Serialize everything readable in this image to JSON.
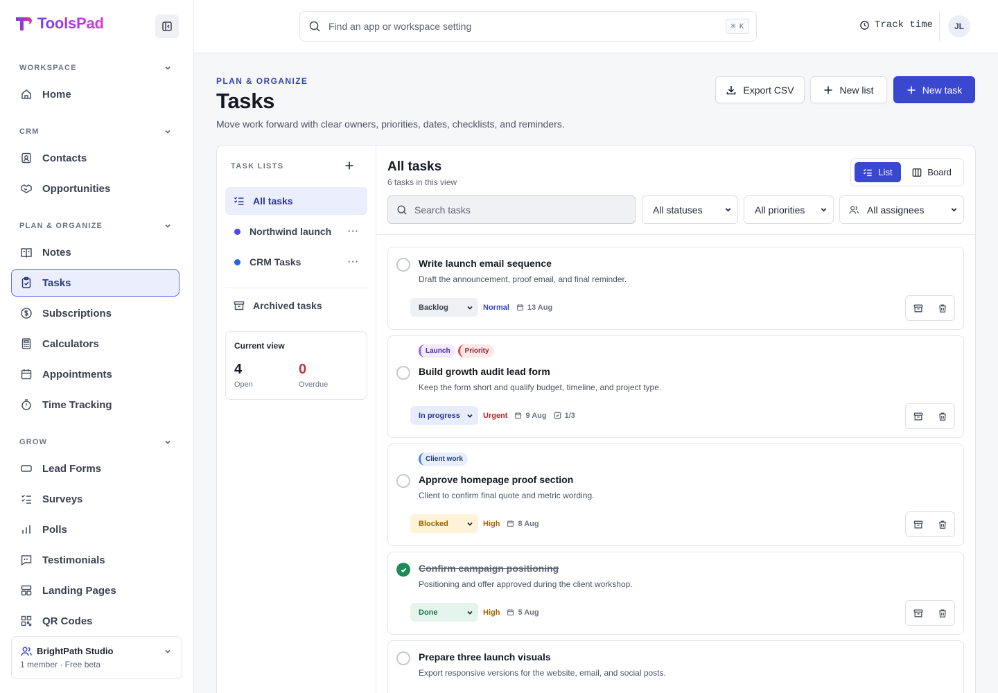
{
  "brand": {
    "name": "ToolsPad"
  },
  "topbar": {
    "search_placeholder": "Find an app or workspace setting",
    "shortcut": "⌘ K",
    "track_time": "Track time",
    "avatar_initials": "JL"
  },
  "sidebar": {
    "sections": {
      "workspace": "WORKSPACE",
      "crm": "CRM",
      "plan": "PLAN & ORGANIZE",
      "grow": "GROW"
    },
    "items": {
      "home": "Home",
      "contacts": "Contacts",
      "opportunities": "Opportunities",
      "notes": "Notes",
      "tasks": "Tasks",
      "subscriptions": "Subscriptions",
      "calculators": "Calculators",
      "appointments": "Appointments",
      "time_tracking": "Time Tracking",
      "lead_forms": "Lead Forms",
      "surveys": "Surveys",
      "polls": "Polls",
      "testimonials": "Testimonials",
      "landing_pages": "Landing Pages",
      "qr_codes": "QR Codes"
    },
    "workspace_card": {
      "name": "BrightPath Studio",
      "sub": "1 member · Free beta"
    }
  },
  "page": {
    "eyebrow": "PLAN & ORGANIZE",
    "title": "Tasks",
    "subtitle": "Move work forward with clear owners, priorities, dates, checklists, and reminders.",
    "buttons": {
      "export": "Export CSV",
      "new_list": "New list",
      "new_task": "New task"
    }
  },
  "lists": {
    "heading": "TASK LISTS",
    "all": "All tasks",
    "northwind": "Northwind launch",
    "crm": "CRM Tasks",
    "archived": "Archived tasks",
    "more": "···",
    "current_view": {
      "title": "Current view",
      "open": "4",
      "open_label": "Open",
      "overdue": "0",
      "overdue_label": "Overdue"
    },
    "colors": {
      "northwind": "#4f46e5",
      "crm": "#2563eb"
    }
  },
  "tasks_view": {
    "title": "All tasks",
    "count": "6 tasks in this view",
    "toggle": {
      "list": "List",
      "board": "Board"
    },
    "search_placeholder": "Search tasks",
    "filters": {
      "status": "All statuses",
      "priority": "All priorities",
      "assignee": "All assignees"
    }
  },
  "tasks": [
    {
      "title": "Write launch email sequence",
      "desc": "Draft the announcement, proof email, and final reminder.",
      "status": "Backlog",
      "priority": "Normal",
      "date": "13 Aug"
    },
    {
      "tags": [
        "Launch",
        "Priority"
      ],
      "title": "Build growth audit lead form",
      "desc": "Keep the form short and qualify budget, timeline, and project type.",
      "status": "In progress",
      "priority": "Urgent",
      "date": "9 Aug",
      "checklist": "1/3"
    },
    {
      "tags": [
        "Client work"
      ],
      "title": "Approve homepage proof section",
      "desc": "Client to confirm final quote and metric wording.",
      "status": "Blocked",
      "priority": "High",
      "date": "8 Aug"
    },
    {
      "title": "Confirm campaign positioning",
      "desc": "Positioning and offer approved during the client workshop.",
      "status": "Done",
      "priority": "High",
      "date": "5 Aug"
    },
    {
      "title": "Prepare three launch visuals",
      "desc": "Export responsive versions for the website, email, and social posts."
    }
  ]
}
